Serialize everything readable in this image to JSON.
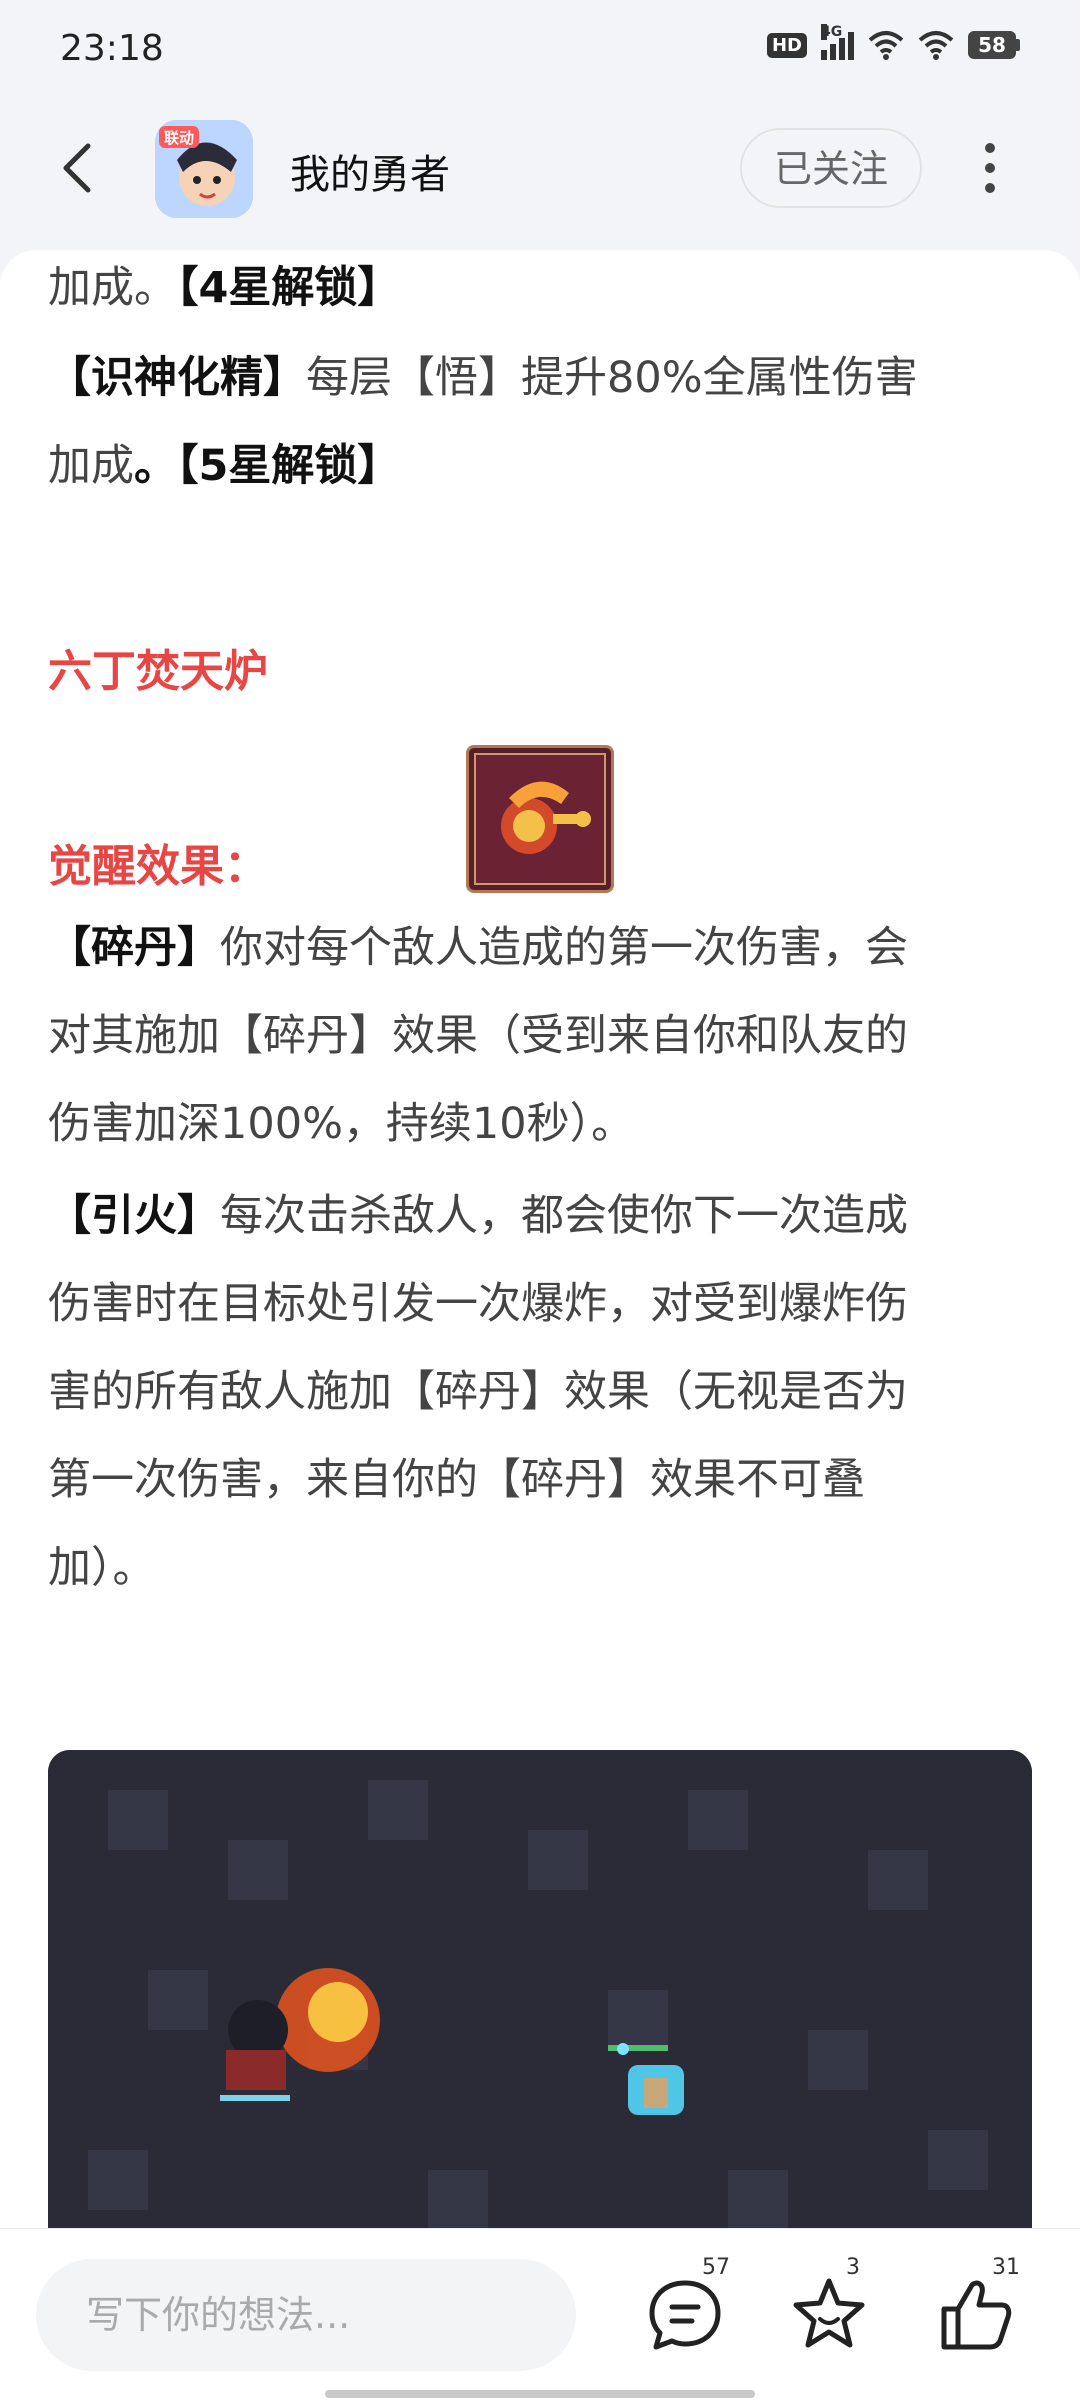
{
  "status_bar": {
    "time": "23:18",
    "hd_label": "HD",
    "network_label": "4G",
    "battery": "58"
  },
  "header": {
    "title": "我的勇者",
    "follow_label": "已关注",
    "app_icon_label": "联动"
  },
  "content": {
    "p1_normal": "加成。",
    "p1_bold": "【4星解锁】",
    "p2_bold": "【识神化精】",
    "p2_line1": "每层【悟】提升80%全属性伤害",
    "p2_line2_normal": "加成",
    "p2_line2_bold": "。【5星解锁】",
    "section_title": "六丁焚天炉",
    "effect_title": "觉醒效果：",
    "p3_bold": "【碎丹】",
    "p3_line1": "你对每个敌人造成的第一次伤害，会",
    "p3_line2": "对其施加【碎丹】效果（受到来自你和队友的",
    "p3_line3": "伤害加深100%，持续10秒）。",
    "p4_bold": "【引火】",
    "p4_line1": "每次击杀敌人，都会使你下一次造成",
    "p4_line2": "伤害时在目标处引发一次爆炸，对受到爆炸伤",
    "p4_line3": "害的所有敌人施加【碎丹】效果（无视是否为",
    "p4_line4": "第一次伤害，来自你的【碎丹】效果不可叠",
    "p4_line5": "加）。"
  },
  "bottom_bar": {
    "comment_placeholder": "写下你的想法...",
    "comment_count": "57",
    "favorite_count": "3",
    "like_count": "31"
  },
  "colors": {
    "accent_red": "#e84545",
    "card_bg": "#ffffff",
    "page_bg": "#f3f4f7"
  }
}
